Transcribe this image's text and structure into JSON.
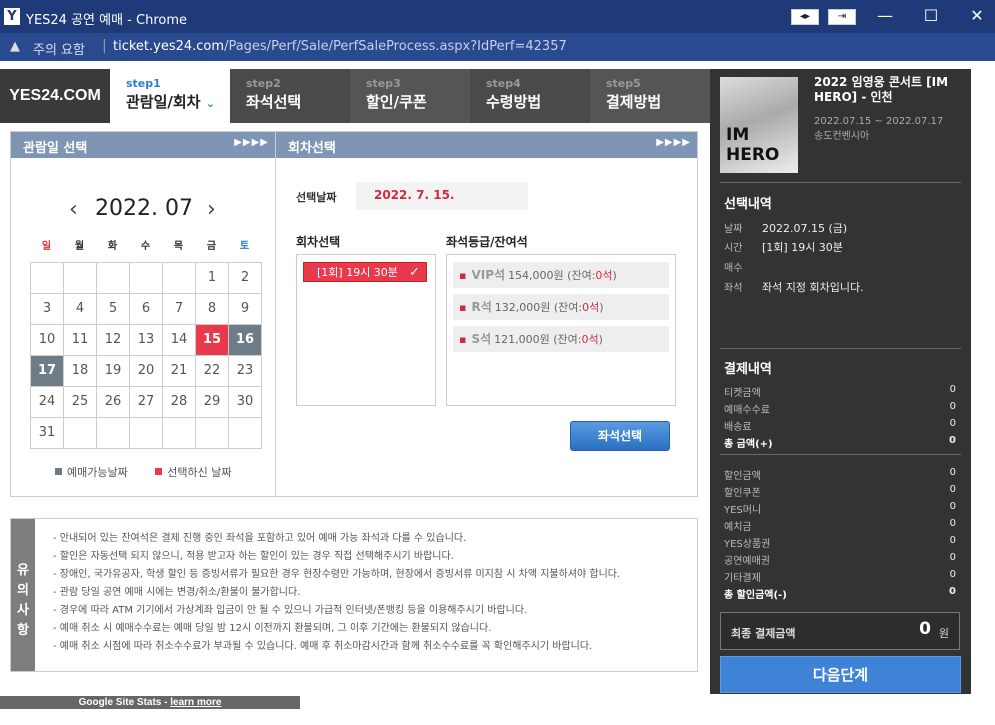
{
  "window": {
    "app_icon": "Y",
    "title": "YES24 공연 예매 - Chrome"
  },
  "addressbar": {
    "security_icon": "warning-triangle-icon",
    "security_label": "주의 요함",
    "url_host": "ticket.yes24.com",
    "url_path": "/Pages/Perf/Sale/PerfSaleProcess.aspx?IdPerf=42357"
  },
  "header": {
    "logo": "YES24.COM",
    "steps": [
      {
        "num": "step1",
        "label": "관람일/회차",
        "active": true
      },
      {
        "num": "step2",
        "label": "좌석선택"
      },
      {
        "num": "step3",
        "label": "할인/쿠폰"
      },
      {
        "num": "step4",
        "label": "수령방법"
      },
      {
        "num": "step5",
        "label": "결제방법"
      }
    ]
  },
  "date_panel": {
    "title": "관람일 선택",
    "month": "2022. 07",
    "weekdays": [
      "일",
      "월",
      "화",
      "수",
      "목",
      "금",
      "토"
    ],
    "days": [
      "",
      "",
      "",
      "",
      "",
      "1",
      "2",
      "3",
      "4",
      "5",
      "6",
      "7",
      "8",
      "9",
      "10",
      "11",
      "12",
      "13",
      "14",
      "15",
      "16",
      "17",
      "18",
      "19",
      "20",
      "21",
      "22",
      "23",
      "24",
      "25",
      "26",
      "27",
      "28",
      "29",
      "30",
      "31",
      "",
      "",
      "",
      "",
      "",
      ""
    ],
    "selected_day": "15",
    "available_days": [
      "16",
      "17"
    ],
    "legend_available": "예매가능날짜",
    "legend_selected": "선택하신 날짜",
    "colors": {
      "selected": "#e8394d",
      "available": "#6d7c87"
    }
  },
  "round_panel": {
    "title": "회차선택",
    "selected_date_label": "선택날짜",
    "selected_date_value": "2022. 7. 15.",
    "round_title": "회차선택",
    "rounds": [
      "[1회] 19시 30분"
    ],
    "grade_title": "좌석등급/잔여석",
    "grades": [
      {
        "name": "VIP석",
        "price": "154,000원",
        "remain_prefix": "(잔여:",
        "remain": "0석",
        "remain_suffix": ")"
      },
      {
        "name": "R석",
        "price": "132,000원",
        "remain_prefix": "(잔여:",
        "remain": "0석",
        "remain_suffix": ")"
      },
      {
        "name": "S석",
        "price": "121,000원",
        "remain_prefix": "(잔여:",
        "remain": "0석",
        "remain_suffix": ")"
      }
    ],
    "seat_button": "좌석선택"
  },
  "notice": {
    "side_label": [
      "유",
      "의",
      "사",
      "항"
    ],
    "items": [
      "- 안내되어 있는 잔여석은 결제 진행 중인 좌석을 포함하고 있어 예매 가능 좌석과 다를 수 있습니다.",
      "- 할인은 자동선택 되지 않으니, 적용 받고자 하는 할인이 있는 경우 직접 선택해주시기 바랍니다.",
      "- 장애인, 국가유공자, 학생 할인 등 증빙서류가 필요한 경우 현장수령만 가능하며, 현장에서 증빙서류 미지참 시 차액 지불하셔야 합니다.",
      "- 관람 당일 공연 예매 시에는 변경/취소/환불이 불가합니다.",
      "- 경우에 따라 ATM 기기에서 가상계좌 입금이 안 될 수 있으니 가급적 인터넷/폰뱅킹 등을 이용해주시기 바랍니다.",
      "- 예매 취소 시 예매수수료는 예매 당일 밤 12시 이전까지 환불되며, 그 이후 기간에는 환불되지 않습니다.",
      "- 예매 취소 시점에 따라 취소수수료가 부과될 수 있습니다. 예매 후 취소마감시간과 함께 취소수수료를 꼭 확인해주시기 바랍니다."
    ]
  },
  "stats": {
    "label": "Google Site Stats - ",
    "link": "learn more"
  },
  "sidebar": {
    "concert_title": "2022 임영웅 콘서트 [IM HERO] - 인천",
    "concert_dates": "2022.07.15 ~ 2022.07.17",
    "venue": "송도컨벤시아",
    "poster_text": "IM HERO",
    "selection_title": "선택내역",
    "selection": [
      {
        "k": "날짜",
        "v": "2022.07.15 (금)"
      },
      {
        "k": "시간",
        "v": "[1회] 19시 30분"
      },
      {
        "k": "매수",
        "v": ""
      },
      {
        "k": "좌석",
        "v": "좌석 지정 회차입니다."
      }
    ],
    "payment_title": "결제내역",
    "payments": [
      {
        "k": "티켓금액",
        "v": "0"
      },
      {
        "k": "예매수수료",
        "v": "0"
      },
      {
        "k": "배송료",
        "v": "0"
      },
      {
        "k": "총 금액(+)",
        "v": "0",
        "bold": true
      }
    ],
    "discounts": [
      {
        "k": "할인금액",
        "v": "0"
      },
      {
        "k": "할인쿠폰",
        "v": "0"
      },
      {
        "k": "YES머니",
        "v": "0"
      },
      {
        "k": "예치금",
        "v": "0"
      },
      {
        "k": "YES상품권",
        "v": "0"
      },
      {
        "k": "공연예매권",
        "v": "0"
      },
      {
        "k": "기타결제",
        "v": "0"
      },
      {
        "k": "총 할인금액(-)",
        "v": "0",
        "bold": true
      }
    ],
    "final_label": "최종 결제금액",
    "final_value": "0",
    "final_unit": "원",
    "next_button": "다음단계"
  }
}
